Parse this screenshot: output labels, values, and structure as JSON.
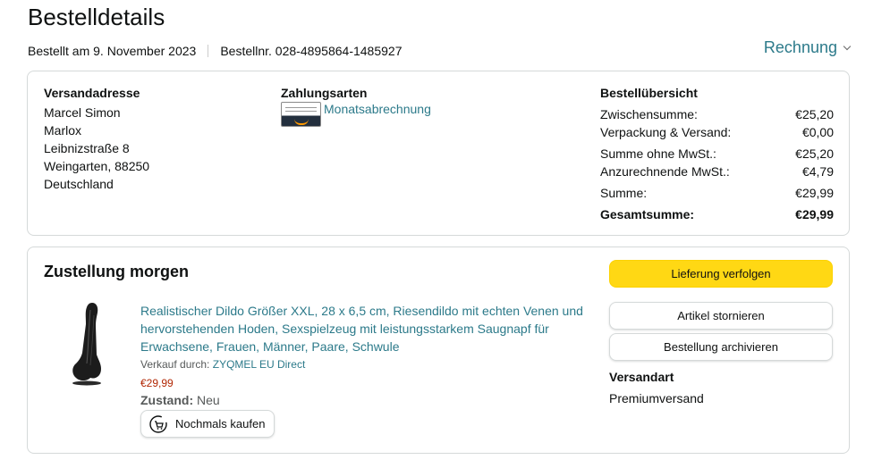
{
  "page": {
    "title": "Bestelldetails",
    "ordered_on": "Bestellt am 9. November 2023",
    "order_number": "Bestellnr. 028-4895864-1485927",
    "invoice_label": "Rechnung"
  },
  "shipping_address": {
    "heading": "Versandadresse",
    "lines": [
      "Marcel Simon",
      "Marlox",
      "Leibnizstraße 8",
      "Weingarten, 88250",
      "Deutschland"
    ]
  },
  "payment": {
    "heading": "Zahlungsarten",
    "method": "Monatsabrechnung"
  },
  "summary": {
    "heading": "Bestellübersicht",
    "rows": [
      {
        "label": "Zwischensumme:",
        "value": "€25,20"
      },
      {
        "label": "Verpackung & Versand:",
        "value": "€0,00"
      },
      {
        "label": "Summe ohne MwSt.:",
        "value": "€25,20"
      },
      {
        "label": "Anzurechnende MwSt.:",
        "value": "€4,79"
      },
      {
        "label": "Summe:",
        "value": "€29,99"
      },
      {
        "label": "Gesamtsumme:",
        "value": "€29,99"
      }
    ]
  },
  "delivery": {
    "heading": "Zustellung morgen",
    "product_title": "Realistischer Dildo Größer XXL, 28 x 6,5 cm, Riesendildo mit echten Venen und hervorstehenden Hoden, Sexspielzeug mit leistungsstarkem Saugnapf für Erwachsene, Frauen, Männer, Paare, Schwule",
    "seller_prefix": "Verkauf durch:",
    "seller": "ZYQMEL EU Direct",
    "price": "€29,99",
    "condition_label": "Zustand:",
    "condition_value": "Neu",
    "buy_again": "Nochmals kaufen"
  },
  "actions": {
    "track": "Lieferung verfolgen",
    "cancel": "Artikel stornieren",
    "archive": "Bestellung archivieren"
  },
  "shipping_method": {
    "heading": "Versandart",
    "value": "Premiumversand"
  },
  "colors": {
    "link": "#2c7a8a",
    "primary_button": "#ffd814",
    "price": "#b12704",
    "border": "#d5d9d9"
  }
}
